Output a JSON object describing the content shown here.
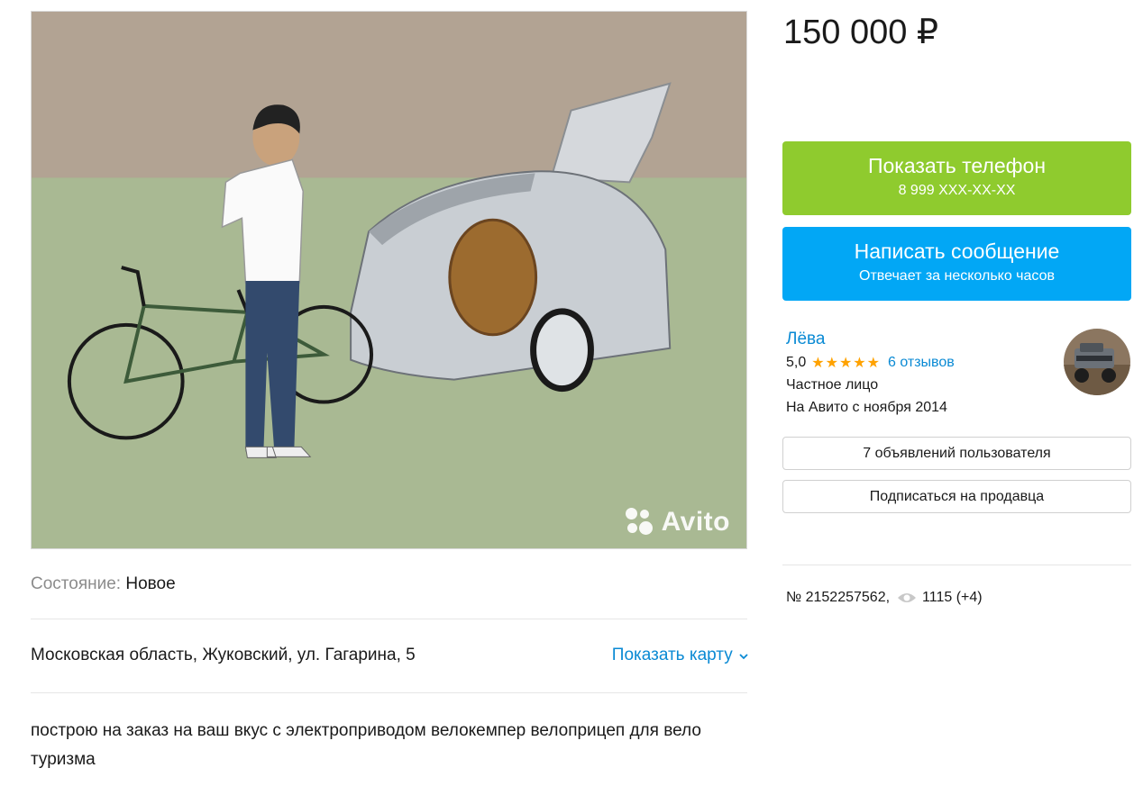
{
  "listing": {
    "price": "150 000 ₽",
    "watermark": "Avito",
    "condition_label": "Состояние:",
    "condition_value": "Новое",
    "address": "Московская область, Жуковский, ул. Гагарина, 5",
    "show_map": "Показать карту",
    "description": "построю на заказ на ваш вкус с электроприводом велокемпер велоприцеп для вело туризма",
    "ad_number": "№ 2152257562,",
    "views": "1115 (+4)"
  },
  "actions": {
    "phone_title": "Показать телефон",
    "phone_number": "8 999 XXX-XX-XX",
    "message_title": "Написать сообщение",
    "message_sub": "Отвечает за несколько часов",
    "user_ads": "7 объявлений пользователя",
    "subscribe": "Подписаться на продавца"
  },
  "seller": {
    "name": "Лёва",
    "rating": "5,0",
    "stars": "★★★★★",
    "reviews": "6 отзывов",
    "type": "Частное лицо",
    "since": "На Авито с ноября 2014"
  },
  "colors": {
    "phone_button": "#8fcb2e",
    "message_button": "#02a7f5",
    "link": "#0a8ad4",
    "star": "#ffa200"
  },
  "icons": {
    "eye": "eye-icon",
    "chevron": "chevron-down-icon",
    "watermark": "avito-logo-icon"
  }
}
